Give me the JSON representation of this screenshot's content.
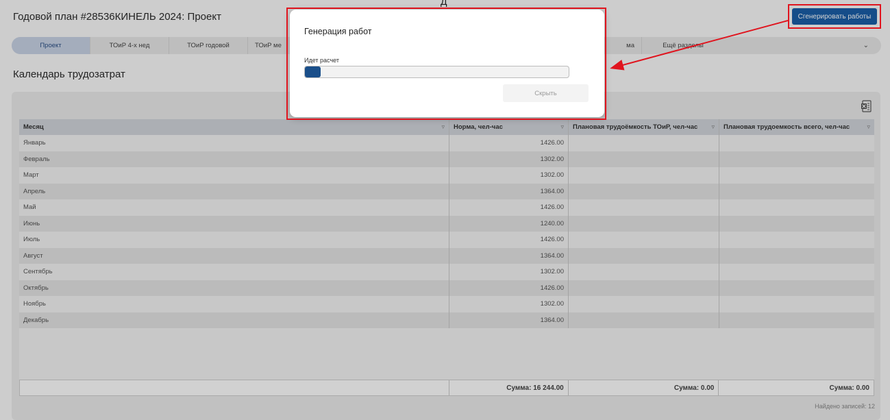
{
  "header": {
    "title": "Годовой план #28536КИНЕЛЬ 2024: Проект",
    "generate_label": "Сгенерировать работы",
    "top_glyph": "Д"
  },
  "tabs": [
    {
      "label": "Проект",
      "active": true
    },
    {
      "label": "ТОиР 4-х нед"
    },
    {
      "label": "ТОиР годовой"
    },
    {
      "label": "ТОиР ме"
    },
    {
      "label": "ма"
    },
    {
      "label": "Ещё разделы"
    }
  ],
  "section_title": "Календарь трудозатрат",
  "table": {
    "columns": [
      "Месяц",
      "Норма, чел-час",
      "Плановая трудоёмкость ТОиР, чел-час",
      "Плановая трудоемкость всего, чел-час"
    ],
    "rows": [
      {
        "month": "Январь",
        "norm": "1426.00"
      },
      {
        "month": "Февраль",
        "norm": "1302.00"
      },
      {
        "month": "Март",
        "norm": "1302.00"
      },
      {
        "month": "Апрель",
        "norm": "1364.00"
      },
      {
        "month": "Май",
        "norm": "1426.00"
      },
      {
        "month": "Июнь",
        "norm": "1240.00"
      },
      {
        "month": "Июль",
        "norm": "1426.00"
      },
      {
        "month": "Август",
        "norm": "1364.00"
      },
      {
        "month": "Сентябрь",
        "norm": "1302.00"
      },
      {
        "month": "Октябрь",
        "norm": "1426.00"
      },
      {
        "month": "Ноябрь",
        "norm": "1302.00"
      },
      {
        "month": "Декабрь",
        "norm": "1364.00"
      }
    ],
    "totals": {
      "norm": "Сумма: 16 244.00",
      "toir": "Сумма: 0.00",
      "total": "Сумма: 0.00"
    },
    "records_found": "Найдено записей: 12"
  },
  "modal": {
    "title": "Генерация работ",
    "status": "Идет расчет",
    "progress_fraction": 0.06,
    "hide_label": "Скрыть"
  },
  "colors": {
    "accent": "#1a5fa8",
    "highlight": "#e0141e"
  }
}
